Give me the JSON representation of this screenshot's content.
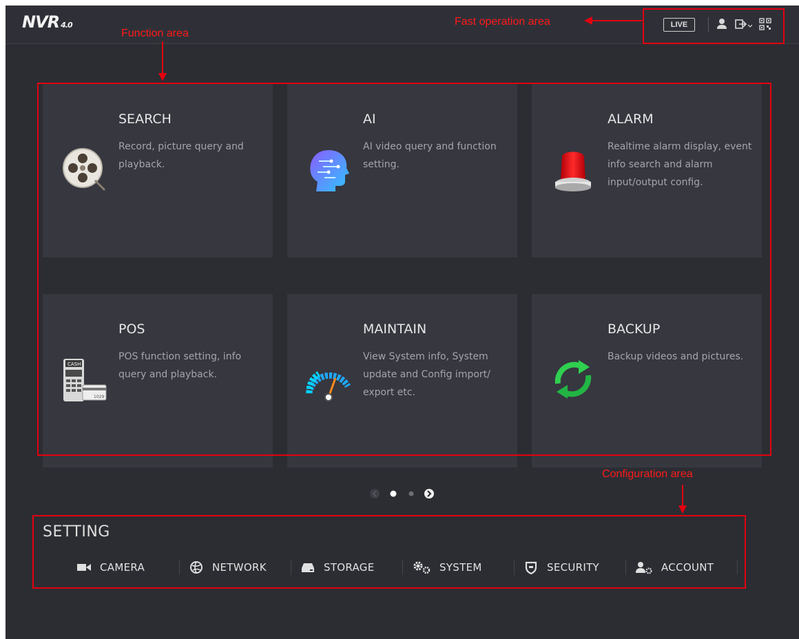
{
  "header": {
    "logo_text": "NVR",
    "logo_version": "4.0",
    "live_label": "LIVE",
    "icons": [
      "user-icon",
      "logout-icon",
      "qr-code-icon"
    ]
  },
  "tiles": [
    {
      "title": "SEARCH",
      "desc": "Record, picture query and playback.",
      "icon": "film-reel-icon"
    },
    {
      "title": "AI",
      "desc": "AI video query and function setting.",
      "icon": "ai-head-icon"
    },
    {
      "title": "ALARM",
      "desc": "Realtime alarm display, event info search and alarm input/output config.",
      "icon": "alarm-light-icon"
    },
    {
      "title": "POS",
      "desc": "POS function setting, info query and playback.",
      "icon": "pos-terminal-icon"
    },
    {
      "title": "MAINTAIN",
      "desc": "View System info, System update and Config import/ export etc.",
      "icon": "gauge-icon"
    },
    {
      "title": "BACKUP",
      "desc": "Backup videos and pictures.",
      "icon": "sync-arrows-icon"
    }
  ],
  "pagination": {
    "pages": 2,
    "current": 1
  },
  "setting": {
    "title": "SETTING",
    "items": [
      {
        "label": "CAMERA",
        "icon": "camera-icon"
      },
      {
        "label": "NETWORK",
        "icon": "network-globe-icon"
      },
      {
        "label": "STORAGE",
        "icon": "storage-drive-icon"
      },
      {
        "label": "SYSTEM",
        "icon": "gears-icon"
      },
      {
        "label": "SECURITY",
        "icon": "shield-icon"
      },
      {
        "label": "ACCOUNT",
        "icon": "user-settings-icon"
      }
    ]
  },
  "annotations": {
    "function_area": "Function area",
    "fast_operation_area": "Fast operation area",
    "configuration_area": "Configuration area",
    "color": "#e3000f"
  }
}
